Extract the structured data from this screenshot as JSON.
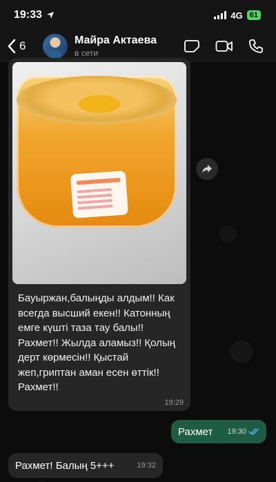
{
  "status_bar": {
    "time": "19:33",
    "network": "4G",
    "battery": "61"
  },
  "header": {
    "back_count": "6",
    "contact_name": "Майра Актаева",
    "contact_status": "в сети"
  },
  "messages": [
    {
      "direction": "incoming",
      "type": "photo",
      "text": "Бауыржан,балыңды алдым!! Как всегда высший екен!! Катонның емге күшті таза тау балы!! Рахмет!! Жылда аламыз!! Қолың дерт көрмесін!! Қыстай жеп,гриптан аман есен өттік!! Рахмет!!",
      "time": "19:29"
    },
    {
      "direction": "outgoing",
      "text": "Рахмет",
      "time": "19:30",
      "read": true
    },
    {
      "direction": "incoming",
      "text": "Рахмет! Балың 5+++",
      "time": "19:32"
    }
  ],
  "colors": {
    "outgoing_bubble": "#1f5c45",
    "incoming_bubble": "#262626",
    "read_ticks": "#53bdeb"
  }
}
